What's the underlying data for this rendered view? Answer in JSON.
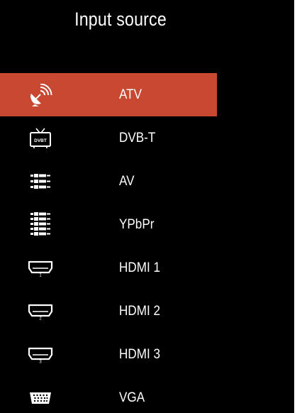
{
  "title": "Input source",
  "colors": {
    "background": "#000000",
    "selected": "#c84832",
    "text": "#ffffff"
  },
  "sources": [
    {
      "label": "ATV",
      "icon": "satellite-dish-icon",
      "selected": true
    },
    {
      "label": "DVB-T",
      "icon": "dvbt-tv-icon",
      "selected": false,
      "icon_text": "DVBT"
    },
    {
      "label": "AV",
      "icon": "av-rca-icon",
      "selected": false
    },
    {
      "label": "YPbPr",
      "icon": "ypbpr-component-icon",
      "selected": false
    },
    {
      "label": "HDMI 1",
      "icon": "hdmi-port-icon",
      "selected": false,
      "icon_text": "1"
    },
    {
      "label": "HDMI 2",
      "icon": "hdmi-port-icon",
      "selected": false,
      "icon_text": "2"
    },
    {
      "label": "HDMI 3",
      "icon": "hdmi-port-icon",
      "selected": false,
      "icon_text": "3"
    },
    {
      "label": "VGA",
      "icon": "vga-port-icon",
      "selected": false
    }
  ]
}
